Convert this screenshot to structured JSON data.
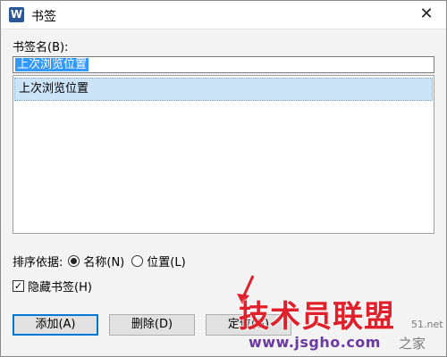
{
  "window": {
    "title": "书签",
    "app_icon_letter": "W",
    "close_glyph": "✕"
  },
  "bookmark_name": {
    "label": "书签名(B):",
    "value": "上次浏览位置"
  },
  "bookmarks": [
    {
      "label": "上次浏览位置",
      "selected": true
    }
  ],
  "sort": {
    "label": "排序依据:",
    "options": [
      {
        "label": "名称(N)",
        "checked": true
      },
      {
        "label": "位置(L)",
        "checked": false
      }
    ]
  },
  "hide_bookmarks": {
    "label": "隐藏书签(H)",
    "checked": true,
    "check_glyph": "✓"
  },
  "buttons": {
    "add": "添加(A)",
    "delete": "删除(D)",
    "locate": "定位(G)"
  },
  "watermark": {
    "brand": "技术员联盟",
    "url": "www.jsgho.com",
    "tail": "之家",
    "side": "51.net"
  },
  "colors": {
    "selection": "#3399ff",
    "list_highlight": "#cce4f7",
    "watermark_red": "#e0202a"
  }
}
